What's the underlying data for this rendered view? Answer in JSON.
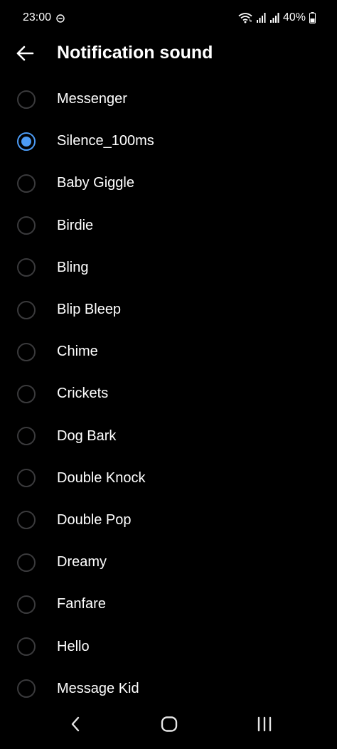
{
  "status_bar": {
    "time": "23:00",
    "battery": "40%",
    "icons": [
      "do-not-disturb-icon",
      "wifi-icon",
      "signal-icon",
      "signal-icon",
      "battery-icon"
    ]
  },
  "header": {
    "back_icon": "arrow-left-icon",
    "title": "Notification sound"
  },
  "accent_color": "#4c9bf5",
  "sounds": [
    {
      "label": "Messenger",
      "selected": false
    },
    {
      "label": "Silence_100ms",
      "selected": true
    },
    {
      "label": "Baby Giggle",
      "selected": false
    },
    {
      "label": "Birdie",
      "selected": false
    },
    {
      "label": "Bling",
      "selected": false
    },
    {
      "label": "Blip Bleep",
      "selected": false
    },
    {
      "label": "Chime",
      "selected": false
    },
    {
      "label": "Crickets",
      "selected": false
    },
    {
      "label": "Dog Bark",
      "selected": false
    },
    {
      "label": "Double Knock",
      "selected": false
    },
    {
      "label": "Double Pop",
      "selected": false
    },
    {
      "label": "Dreamy",
      "selected": false
    },
    {
      "label": "Fanfare",
      "selected": false
    },
    {
      "label": "Hello",
      "selected": false
    },
    {
      "label": "Message Kid",
      "selected": false
    }
  ],
  "nav_bar": {
    "icons": [
      "back-chevron-icon",
      "home-icon",
      "recents-icon"
    ]
  }
}
